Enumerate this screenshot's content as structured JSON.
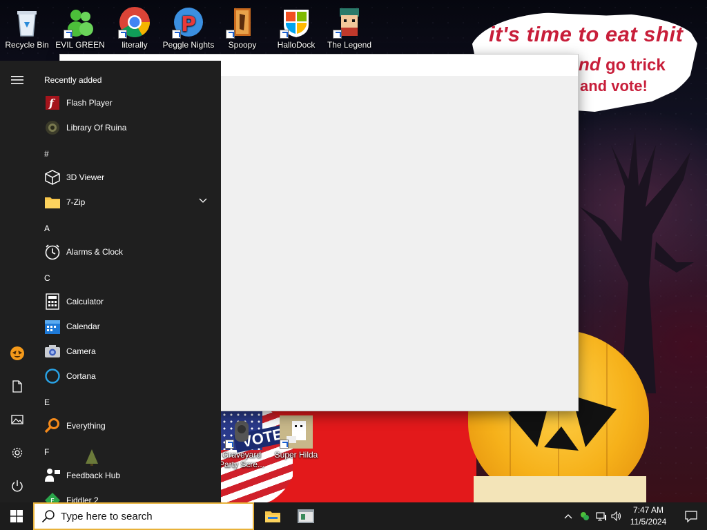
{
  "desktop": {
    "icons": [
      {
        "label": "Recycle Bin"
      },
      {
        "label": "EVIL GREEN MEN CO"
      },
      {
        "label": "literally"
      },
      {
        "label": "Peggle Nights"
      },
      {
        "label": "Spoopy"
      },
      {
        "label": "HalloDock"
      },
      {
        "label": "The Legend"
      },
      {
        "label": "Graveyard Party Scre..."
      },
      {
        "label": "Super Hilda"
      }
    ],
    "wallpaper_text": {
      "line1": "it's time to eat shit",
      "line2_start": "nd",
      "line2_end": "go trick",
      "line3": "and vote!"
    },
    "vote_word": "VOTE"
  },
  "start_menu": {
    "recently_added_label": "Recently added",
    "items": [
      {
        "label": "Flash Player",
        "icon": "flash-player-icon"
      },
      {
        "label": "Library Of Ruina",
        "icon": "library-of-ruina-icon"
      },
      {
        "section": "#"
      },
      {
        "label": "3D Viewer",
        "icon": "3d-viewer-icon"
      },
      {
        "label": "7-Zip",
        "icon": "folder-icon",
        "expandable": true
      },
      {
        "section": "A"
      },
      {
        "label": "Alarms & Clock",
        "icon": "alarm-clock-icon"
      },
      {
        "section": "C"
      },
      {
        "label": "Calculator",
        "icon": "calculator-icon"
      },
      {
        "label": "Calendar",
        "icon": "calendar-icon"
      },
      {
        "label": "Camera",
        "icon": "camera-icon"
      },
      {
        "label": "Cortana",
        "icon": "cortana-icon"
      },
      {
        "section": "E"
      },
      {
        "label": "Everything",
        "icon": "magnifier-icon"
      },
      {
        "section": "F"
      },
      {
        "label": "Feedback Hub",
        "icon": "feedback-hub-icon"
      },
      {
        "label": "Fiddler 2",
        "icon": "fiddler-icon"
      }
    ],
    "sections": {
      "hash": "#",
      "a": "A",
      "c": "C",
      "e": "E",
      "f": "F"
    }
  },
  "taskbar": {
    "search_placeholder": "Type here to search",
    "clock_time": "7:47 AM",
    "clock_date": "11/5/2024"
  },
  "colors": {
    "start_menu_bg": "#1f1f1f",
    "taskbar_bg": "#1c1c1c",
    "search_border": "#e8b23a",
    "wallpaper_text": "#c81e3a",
    "pumpkin": "#f6b11a"
  }
}
